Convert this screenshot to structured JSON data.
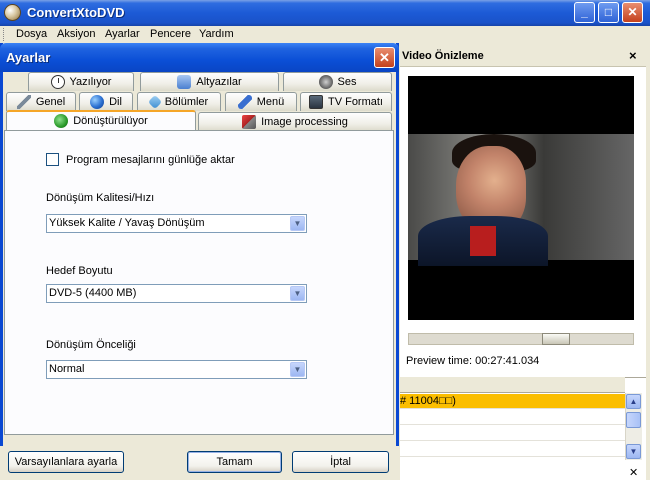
{
  "app": {
    "title": "ConvertXtoDVD"
  },
  "menu": [
    "Dosya",
    "Aksiyon",
    "Ayarlar",
    "Pencere",
    "Yardım"
  ],
  "dialog": {
    "title": "Ayarlar",
    "tabs_row1": [
      "Yazılıyor",
      "Altyazılar",
      "Ses"
    ],
    "tabs_row2": [
      "Genel",
      "Dil",
      "Bölümler",
      "Menü",
      "TV Formatı"
    ],
    "tabs_row3": [
      "Dönüştürülüyor",
      "Image processing"
    ],
    "active_tab": "Dönüştürülüyor",
    "checkbox_label": "Program mesajlarını günlüğe aktar",
    "checkbox_checked": false,
    "quality_label": "Dönüşüm Kalitesi/Hızı",
    "quality_value": "Yüksek Kalite / Yavaş Dönüşüm",
    "size_label": "Hedef Boyutu",
    "size_value": "DVD-5 (4400 MB)",
    "priority_label": "Dönüşüm Önceliği",
    "priority_value": "Normal",
    "buttons": {
      "defaults": "Varsayılanlara ayarla",
      "ok": "Tamam",
      "cancel": "İptal"
    }
  },
  "preview": {
    "title": "Video Önizleme",
    "time_text": "Preview time: 00:27:41.034"
  },
  "list": {
    "selected_row": "# 11004□□)"
  },
  "colors": {
    "title_blue": "#0a48d2",
    "tab_accent": "#f5a628",
    "selection": "#fbbe00"
  }
}
